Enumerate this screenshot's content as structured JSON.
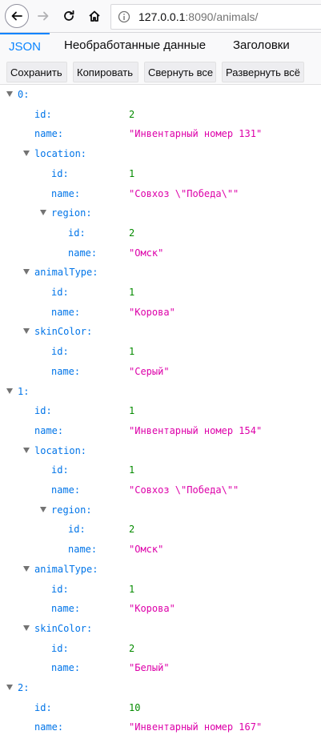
{
  "browser": {
    "url_host": "127.0.0.1",
    "url_rest": ":8090/animals/"
  },
  "viewer": {
    "tabs": [
      "JSON",
      "Необработанные данные",
      "Заголовки"
    ],
    "active_tab": "JSON",
    "actions": [
      "Сохранить",
      "Копировать",
      "Свернуть все",
      "Развернуть всё"
    ]
  },
  "rows": [
    {
      "key": "0:",
      "level": 0,
      "twisty": true
    },
    {
      "key": "id:",
      "level": 1,
      "value": "2",
      "type": "num"
    },
    {
      "key": "name:",
      "level": 1,
      "value": "\"Инвентарный номер 131\"",
      "type": "str"
    },
    {
      "key": "location:",
      "level": 1,
      "twisty": true
    },
    {
      "key": "id:",
      "level": 2,
      "value": "1",
      "type": "num"
    },
    {
      "key": "name:",
      "level": 2,
      "value": "\"Совхоз \\\"Победа\\\"\"",
      "type": "str"
    },
    {
      "key": "region:",
      "level": 2,
      "twisty": true
    },
    {
      "key": "id:",
      "level": 3,
      "value": "2",
      "type": "num"
    },
    {
      "key": "name:",
      "level": 3,
      "value": "\"Омск\"",
      "type": "str"
    },
    {
      "key": "animalType:",
      "level": 1,
      "twisty": true
    },
    {
      "key": "id:",
      "level": 2,
      "value": "1",
      "type": "num"
    },
    {
      "key": "name:",
      "level": 2,
      "value": "\"Корова\"",
      "type": "str"
    },
    {
      "key": "skinColor:",
      "level": 1,
      "twisty": true
    },
    {
      "key": "id:",
      "level": 2,
      "value": "1",
      "type": "num"
    },
    {
      "key": "name:",
      "level": 2,
      "value": "\"Серый\"",
      "type": "str"
    },
    {
      "key": "1:",
      "level": 0,
      "twisty": true
    },
    {
      "key": "id:",
      "level": 1,
      "value": "1",
      "type": "num"
    },
    {
      "key": "name:",
      "level": 1,
      "value": "\"Инвентарный номер 154\"",
      "type": "str"
    },
    {
      "key": "location:",
      "level": 1,
      "twisty": true
    },
    {
      "key": "id:",
      "level": 2,
      "value": "1",
      "type": "num"
    },
    {
      "key": "name:",
      "level": 2,
      "value": "\"Совхоз \\\"Победа\\\"\"",
      "type": "str"
    },
    {
      "key": "region:",
      "level": 2,
      "twisty": true
    },
    {
      "key": "id:",
      "level": 3,
      "value": "2",
      "type": "num"
    },
    {
      "key": "name:",
      "level": 3,
      "value": "\"Омск\"",
      "type": "str"
    },
    {
      "key": "animalType:",
      "level": 1,
      "twisty": true
    },
    {
      "key": "id:",
      "level": 2,
      "value": "1",
      "type": "num"
    },
    {
      "key": "name:",
      "level": 2,
      "value": "\"Корова\"",
      "type": "str"
    },
    {
      "key": "skinColor:",
      "level": 1,
      "twisty": true
    },
    {
      "key": "id:",
      "level": 2,
      "value": "2",
      "type": "num"
    },
    {
      "key": "name:",
      "level": 2,
      "value": "\"Белый\"",
      "type": "str"
    },
    {
      "key": "2:",
      "level": 0,
      "twisty": true
    },
    {
      "key": "id:",
      "level": 1,
      "value": "10",
      "type": "num"
    },
    {
      "key": "name:",
      "level": 1,
      "value": "\"Инвентарный номер 167\"",
      "type": "str"
    }
  ],
  "colors": {
    "key": "#0074e8",
    "number": "#058b00",
    "string": "#dd00a9",
    "accent": "#0a84ff"
  }
}
